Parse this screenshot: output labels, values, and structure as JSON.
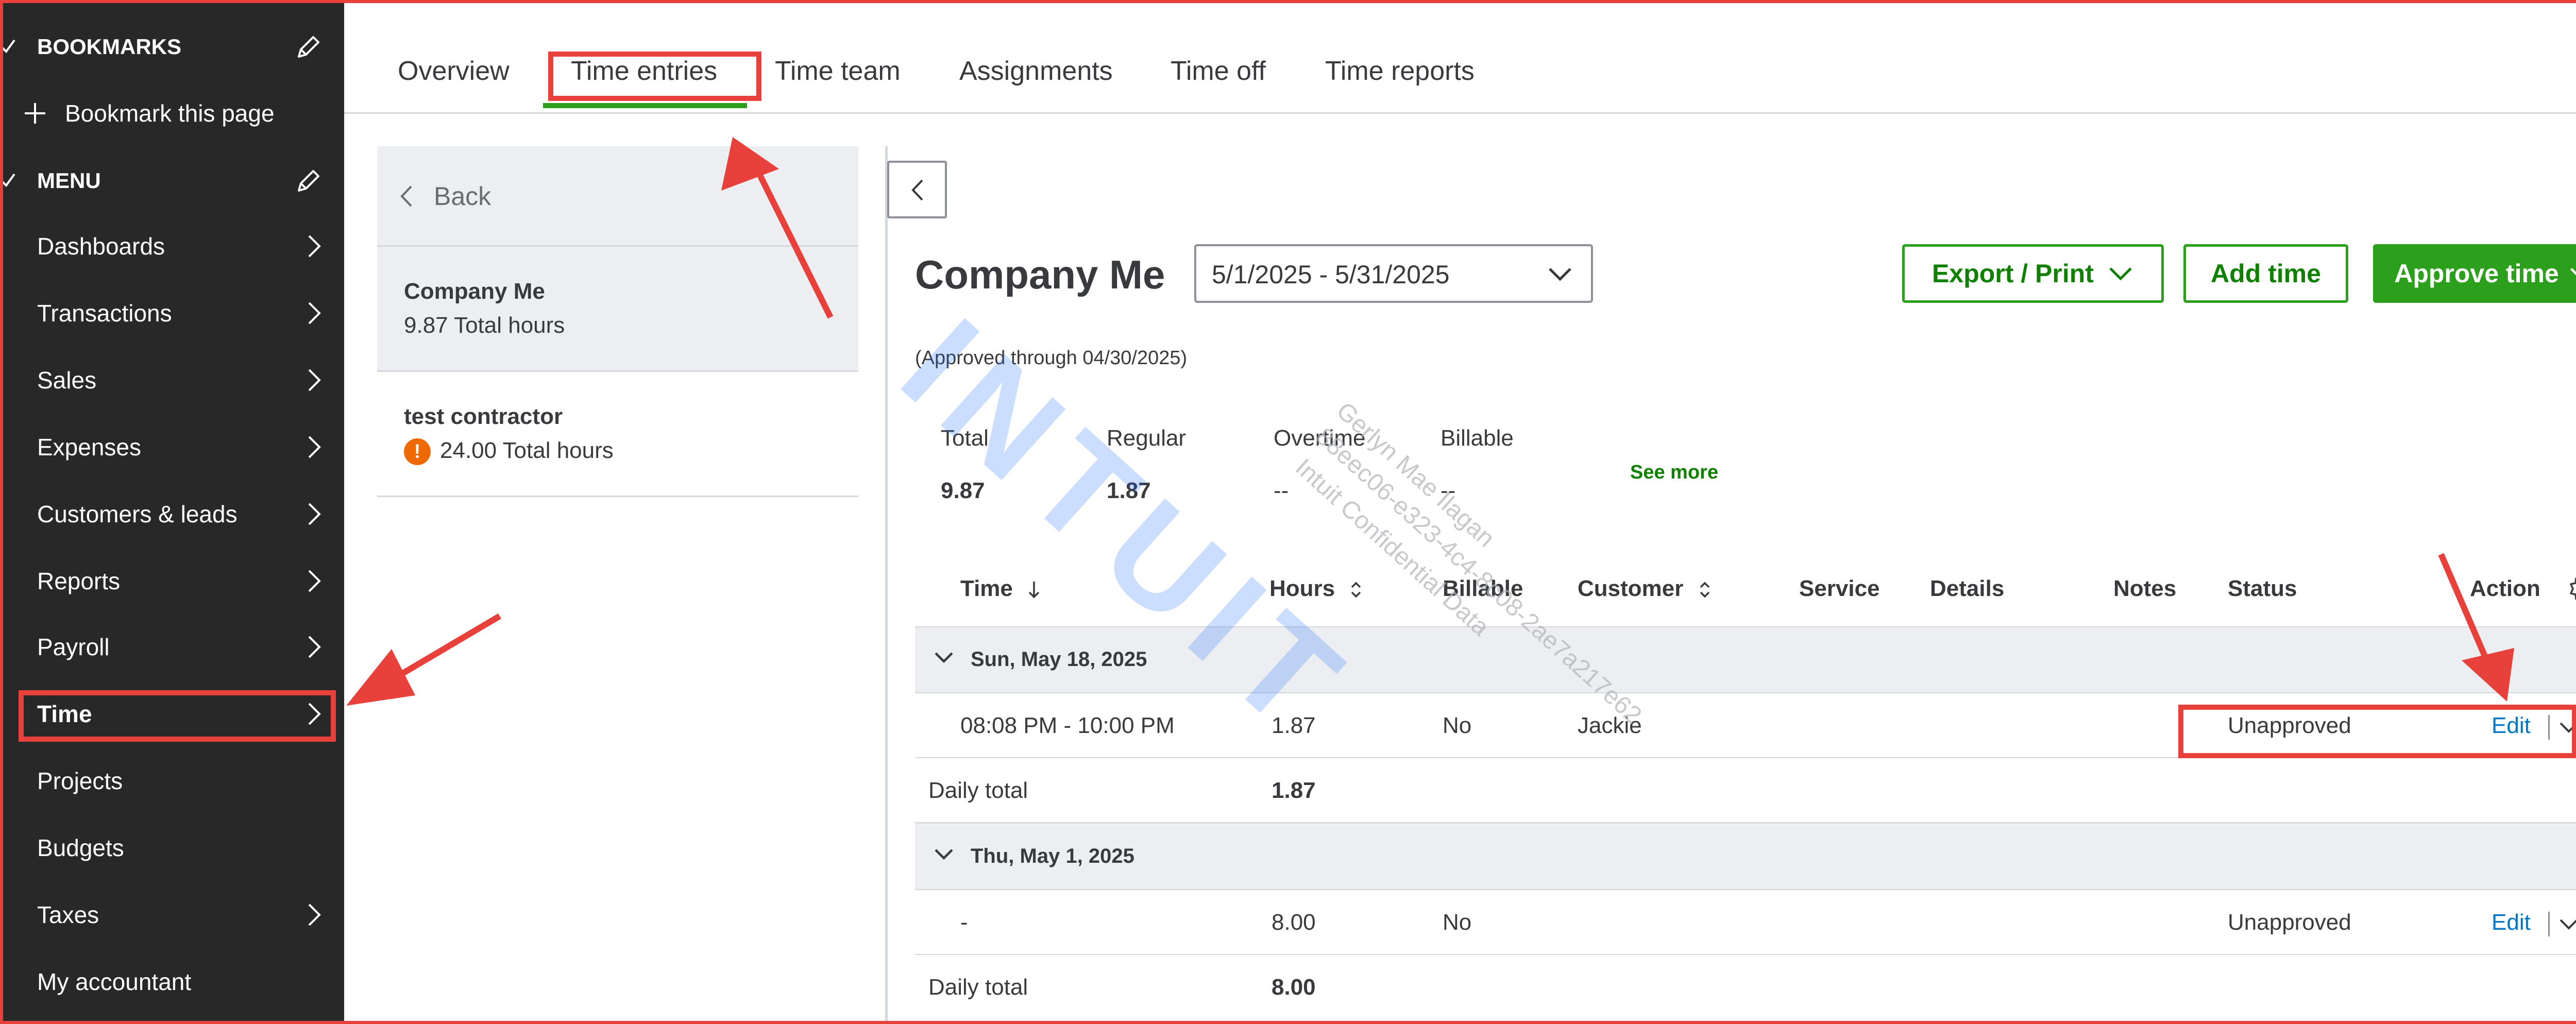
{
  "sidebar": {
    "bookmarks_title": "BOOKMARKS",
    "bookmark_this_page": "Bookmark this page",
    "menu_title": "MENU",
    "items": [
      {
        "label": "Dashboards"
      },
      {
        "label": "Transactions"
      },
      {
        "label": "Sales"
      },
      {
        "label": "Expenses"
      },
      {
        "label": "Customers & leads"
      },
      {
        "label": "Reports"
      },
      {
        "label": "Payroll"
      },
      {
        "label": "Time"
      },
      {
        "label": "Projects"
      },
      {
        "label": "Budgets"
      },
      {
        "label": "Taxes"
      },
      {
        "label": "My accountant"
      }
    ],
    "active": "Time"
  },
  "tabs": [
    "Overview",
    "Time entries",
    "Time team",
    "Assignments",
    "Time off",
    "Time reports"
  ],
  "active_tab": "Time entries",
  "list": {
    "back_label": "Back",
    "people": [
      {
        "name": "Company Me",
        "hours": "9.87 Total hours"
      },
      {
        "name": "test contractor",
        "hours": "24.00 Total hours",
        "warning": "!"
      }
    ]
  },
  "detail": {
    "title": "Company Me",
    "date_range": "5/1/2025 - 5/31/2025",
    "export_print": "Export / Print",
    "add_time": "Add time",
    "approve_time": "Approve time",
    "approved_through": "(Approved through 04/30/2025)",
    "summary": {
      "total_label": "Total",
      "total_value": "9.87",
      "regular_label": "Regular",
      "regular_value": "1.87",
      "overtime_label": "Overtime",
      "overtime_value": "--",
      "billable_label": "Billable",
      "billable_value": "--",
      "see_more": "See more"
    }
  },
  "table": {
    "columns": [
      "Time",
      "Hours",
      "Billable",
      "Customer",
      "Service",
      "Details",
      "Notes",
      "Status",
      "Action"
    ],
    "groups": [
      {
        "date": "Sun, May 18, 2025",
        "entries": [
          {
            "time": "08:08 PM - 10:00 PM",
            "hours": "1.87",
            "billable": "No",
            "customer": "Jackie",
            "status": "Unapproved",
            "action": "Edit"
          }
        ],
        "daily_total_label": "Daily total",
        "daily_total": "1.87"
      },
      {
        "date": "Thu, May 1, 2025",
        "entries": [
          {
            "time": "-",
            "hours": "8.00",
            "billable": "No",
            "customer": "",
            "status": "Unapproved",
            "action": "Edit"
          }
        ],
        "daily_total_label": "Daily total",
        "daily_total": "8.00"
      }
    ]
  },
  "watermark": {
    "brand": "INTUIT",
    "lines": [
      "Gerlyn Mae Ilagan",
      "88eec06-e323-4c4-8c08-2ae7a217e62",
      "Intuit Confidential Data"
    ]
  },
  "colors": {
    "sidebar_bg": "#282828",
    "brand_green": "#2ca01c",
    "link_blue": "#0077c5",
    "annotation_red": "#e8403a",
    "warning_orange": "#ee6a00"
  }
}
